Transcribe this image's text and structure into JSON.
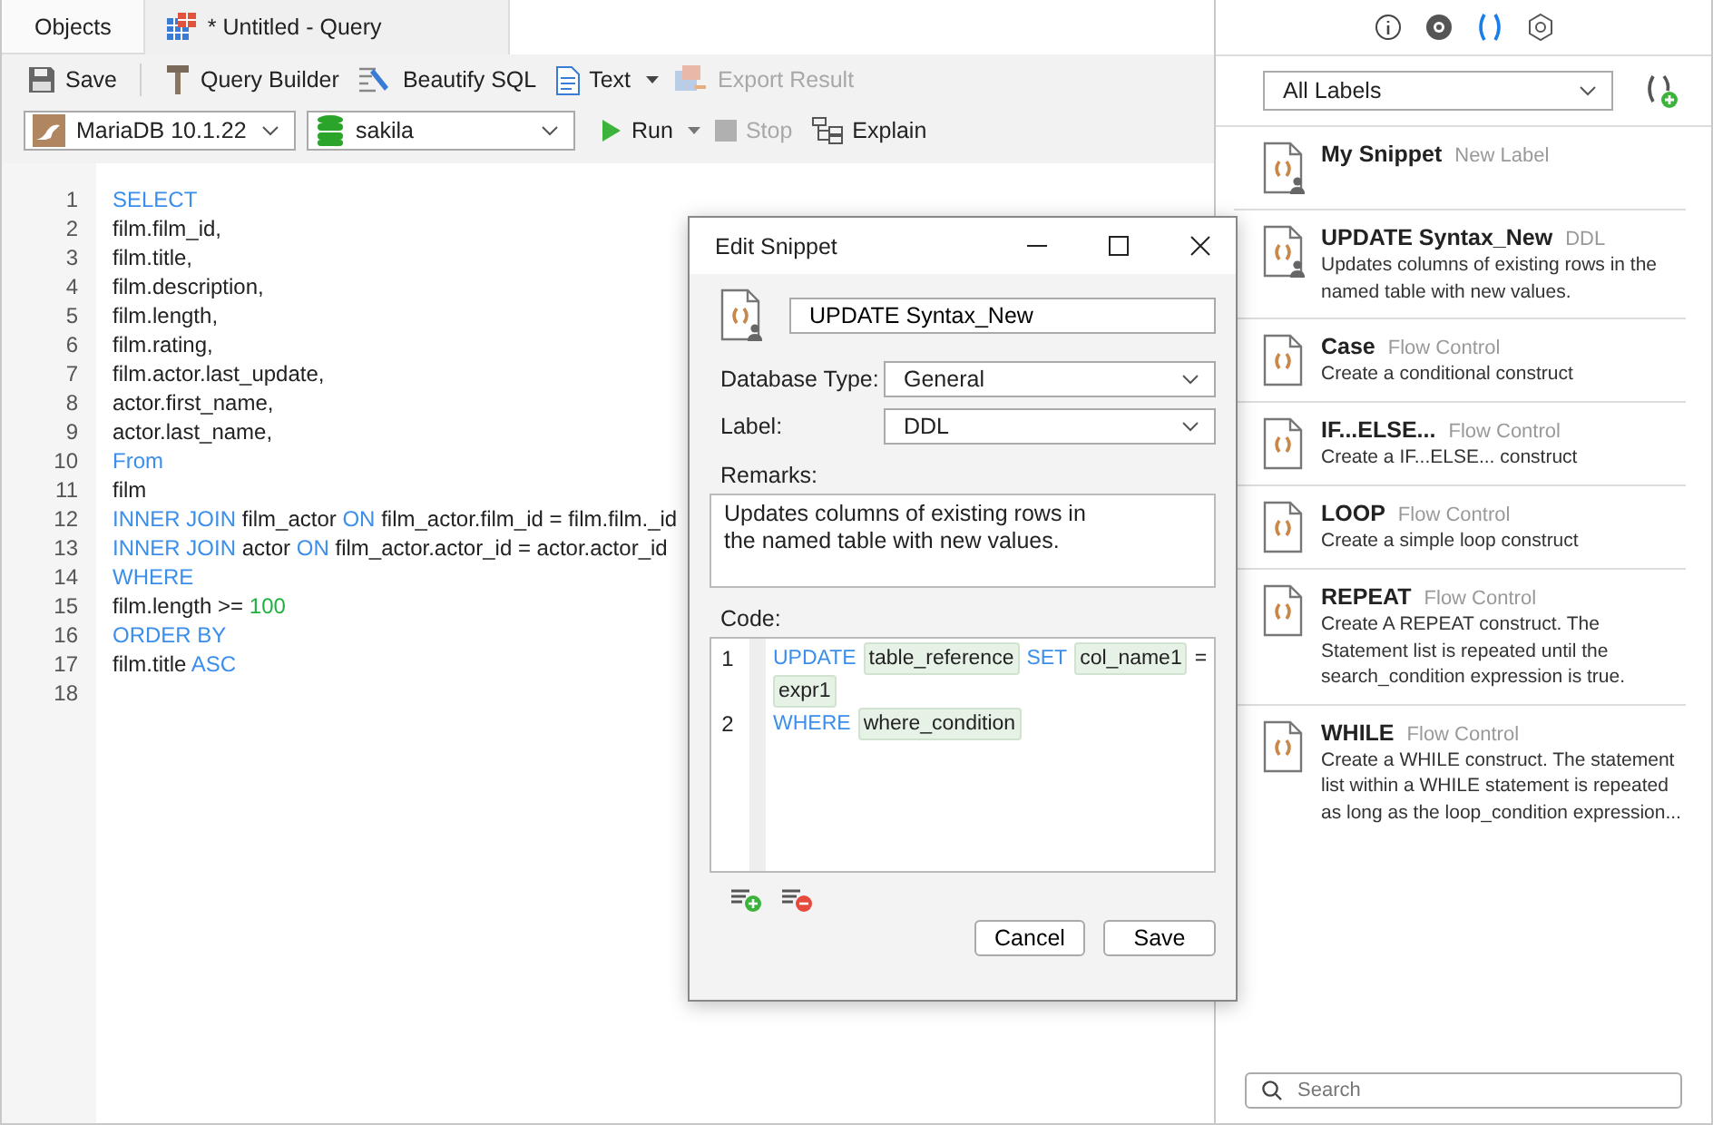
{
  "doc_tabs": [
    {
      "label": "Objects",
      "selected": false,
      "kind": "plain"
    },
    {
      "label": "* Untitled - Query",
      "selected": true,
      "kind": "query"
    }
  ],
  "toolbar": [
    {
      "label": "Save",
      "kind": "save",
      "disabled": false
    },
    {
      "label": "Query Builder",
      "kind": "builder",
      "disabled": false
    },
    {
      "label": "Beautify SQL",
      "kind": "beautify",
      "disabled": false
    },
    {
      "label": "Text",
      "kind": "text",
      "disabled": false
    },
    {
      "label": "Export Result",
      "kind": "export",
      "disabled": true
    }
  ],
  "connection": {
    "value": "MariaDB 10.1.22"
  },
  "database": {
    "value": "sakila"
  },
  "run_bar": [
    {
      "label": "Run",
      "kind": "run",
      "disabled": false
    },
    {
      "label": "Stop",
      "kind": "stop",
      "disabled": true
    },
    {
      "label": "Explain",
      "kind": "explain",
      "disabled": false
    }
  ],
  "editor": {
    "lines": [
      {
        "number": "1",
        "tokens": [
          {
            "text": "SELECT",
            "kind": "keyword"
          }
        ]
      },
      {
        "number": "2",
        "tokens": [
          {
            "text": "film.film_id,",
            "kind": "plain"
          }
        ]
      },
      {
        "number": "3",
        "tokens": [
          {
            "text": "film.title,",
            "kind": "plain"
          }
        ]
      },
      {
        "number": "4",
        "tokens": [
          {
            "text": "film.description,",
            "kind": "plain"
          }
        ]
      },
      {
        "number": "5",
        "tokens": [
          {
            "text": "film.length,",
            "kind": "plain"
          }
        ]
      },
      {
        "number": "6",
        "tokens": [
          {
            "text": "film.rating,",
            "kind": "plain"
          }
        ]
      },
      {
        "number": "7",
        "tokens": [
          {
            "text": "film.actor.last_update,",
            "kind": "plain"
          }
        ]
      },
      {
        "number": "8",
        "tokens": [
          {
            "text": "actor.first_name,",
            "kind": "plain"
          }
        ]
      },
      {
        "number": "9",
        "tokens": [
          {
            "text": "actor.last_name,",
            "kind": "plain"
          }
        ]
      },
      {
        "number": "10",
        "tokens": [
          {
            "text": "From",
            "kind": "keyword"
          }
        ]
      },
      {
        "number": "11",
        "tokens": [
          {
            "text": "film",
            "kind": "plain"
          }
        ]
      },
      {
        "number": "12",
        "tokens": [
          {
            "text": "INNER JOIN",
            "kind": "keyword"
          },
          {
            "text": "film_actor",
            "kind": "plain"
          },
          {
            "text": "ON",
            "kind": "keyword"
          },
          {
            "text": "film_actor.film_id = film.film._id",
            "kind": "plain"
          }
        ]
      },
      {
        "number": "13",
        "tokens": [
          {
            "text": "INNER JOIN",
            "kind": "keyword"
          },
          {
            "text": "actor",
            "kind": "plain"
          },
          {
            "text": "ON",
            "kind": "keyword"
          },
          {
            "text": "film_actor.actor_id = actor.actor_id",
            "kind": "plain"
          }
        ]
      },
      {
        "number": "14",
        "tokens": [
          {
            "text": "WHERE",
            "kind": "keyword"
          }
        ]
      },
      {
        "number": "15",
        "tokens": [
          {
            "text": "film.length >=",
            "kind": "plain"
          },
          {
            "text": "100",
            "kind": "number"
          }
        ]
      },
      {
        "number": "16",
        "tokens": [
          {
            "text": "ORDER BY",
            "kind": "keyword"
          }
        ]
      },
      {
        "number": "17",
        "tokens": [
          {
            "text": "film.title",
            "kind": "plain"
          },
          {
            "text": "ASC",
            "kind": "keyword"
          }
        ]
      },
      {
        "number": "18"
      }
    ]
  },
  "dialog": {
    "title": "Edit Snippet",
    "name": "UPDATE Syntax_New",
    "fields": [
      {
        "label": "Database Type:",
        "value": "General"
      },
      {
        "label": "Label:",
        "value": "DDL"
      }
    ],
    "remarks_label": "Remarks:",
    "remarks": "Updates columns of existing rows in the named table with new values.",
    "code_label": "Code:",
    "code": [
      {
        "number": "1",
        "tokens": [
          {
            "text": "UPDATE",
            "kind": "keyword"
          },
          {
            "text": "table_reference",
            "kind": "placeholder"
          },
          {
            "text": "SET",
            "kind": "keyword"
          },
          {
            "text": "col_name1",
            "kind": "placeholder"
          },
          {
            "text": "=",
            "kind": "plain"
          },
          {
            "text": "expr1",
            "kind": "placeholder"
          }
        ]
      },
      {
        "number": "2",
        "tokens": [
          {
            "text": "WHERE",
            "kind": "keyword"
          },
          {
            "text": "where_condition",
            "kind": "placeholder"
          }
        ]
      }
    ],
    "buttons": [
      "Cancel",
      "Save"
    ]
  },
  "panel_tabs": [
    {
      "kind": "info",
      "selected": false
    },
    {
      "kind": "eye",
      "selected": false
    },
    {
      "kind": "snippet",
      "selected": true
    },
    {
      "kind": "hexagon",
      "selected": false
    }
  ],
  "label_filter": {
    "value": "All Labels"
  },
  "snippets": [
    {
      "name": "My Snippet",
      "label": "New Label",
      "kind": "user"
    },
    {
      "name": "UPDATE Syntax_New",
      "label": "DDL",
      "description": "Updates columns of existing rows in the named table with new values.",
      "kind": "user"
    },
    {
      "name": "Case",
      "label": "Flow Control",
      "description": "Create a conditional construct",
      "kind": "builtin"
    },
    {
      "name": "IF...ELSE...",
      "label": "Flow Control",
      "description": "Create a IF...ELSE... construct",
      "kind": "builtin"
    },
    {
      "name": "LOOP",
      "label": "Flow Control",
      "description": "Create a simple loop construct",
      "kind": "builtin"
    },
    {
      "name": "REPEAT",
      "label": "Flow Control",
      "description": "Create A REPEAT construct. The Statement list is repeated until the search_condition expression is true.",
      "kind": "builtin"
    },
    {
      "name": "WHILE",
      "label": "Flow Control",
      "description": "Create a WHILE construct. The statement list within a WHILE statement is repeated as long as the loop_condition expression...",
      "kind": "builtin"
    }
  ],
  "search": {
    "placeholder": "Search"
  }
}
